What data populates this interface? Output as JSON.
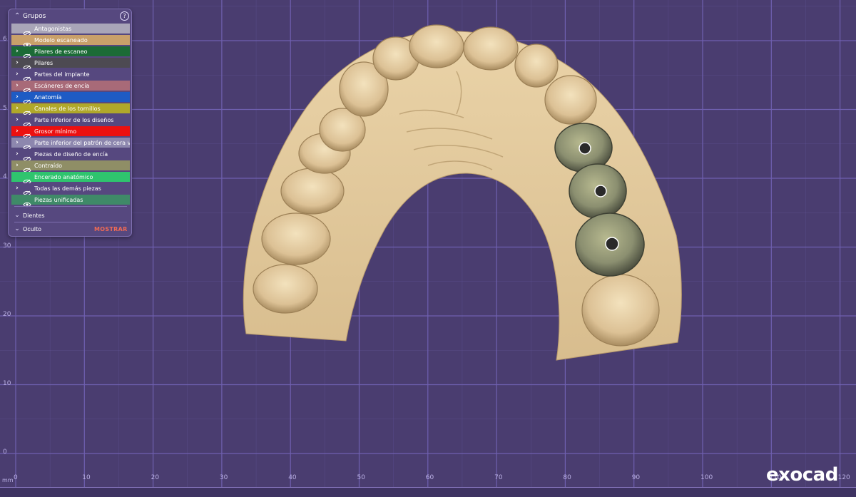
{
  "viewport": {
    "background": "#4a3d70",
    "grid_color": "#6f60b0",
    "unit": "mm",
    "y_ticks": [
      {
        "v": 60,
        "label": "6"
      },
      {
        "v": 50,
        "label": "5"
      },
      {
        "v": 40,
        "label": "4"
      },
      {
        "v": 30,
        "label": "30"
      },
      {
        "v": 20,
        "label": "20"
      },
      {
        "v": 10,
        "label": "10"
      },
      {
        "v": 0,
        "label": "0"
      }
    ],
    "x_ticks": [
      "0",
      "10",
      "20",
      "30",
      "40",
      "50",
      "60",
      "70",
      "80",
      "90",
      "100",
      "110",
      "120"
    ]
  },
  "panel": {
    "title": "Grupos",
    "help_icon": "question-circle-icon",
    "groups": [
      {
        "label": "Antagonistas",
        "color": "#a9a5b8",
        "expand": false,
        "visible": false
      },
      {
        "label": "Modelo escaneado",
        "color": "#c9a06a",
        "expand": false,
        "visible": true
      },
      {
        "label": "Pilares de escaneo",
        "color": "#1c6b36",
        "expand": true,
        "visible": false
      },
      {
        "label": "Pilares",
        "color": "#4d4a52",
        "expand": true,
        "visible": false
      },
      {
        "label": "Partes del implante",
        "color": "#56487f",
        "expand": true,
        "visible": false
      },
      {
        "label": "Escáneres de encía",
        "color": "#a86a78",
        "expand": true,
        "visible": false
      },
      {
        "label": "Anatomía",
        "color": "#1e5bc4",
        "expand": true,
        "visible": false
      },
      {
        "label": "Canales de los tornillos",
        "color": "#b0a82a",
        "expand": true,
        "visible": false
      },
      {
        "label": "Parte inferior de los diseños",
        "color": "#56487f",
        "expand": true,
        "visible": false
      },
      {
        "label": "Grosor mínimo",
        "color": "#ec1010",
        "expand": true,
        "visible": false
      },
      {
        "label": "Parte inferior del patrón de cera virtua",
        "color": "#8d87ae",
        "expand": true,
        "visible": false
      },
      {
        "label": "Piezas de diseño de encía",
        "color": "#56487f",
        "expand": true,
        "visible": false
      },
      {
        "label": "Contraído",
        "color": "#8f8e66",
        "expand": true,
        "visible": false
      },
      {
        "label": "Encerado anatómico",
        "color": "#2fc46e",
        "expand": false,
        "visible": false
      },
      {
        "label": "Todas las demás piezas",
        "color": "#56487f",
        "expand": true,
        "visible": false
      },
      {
        "label": "Piezas unificadas",
        "color": "#3f8a68",
        "expand": false,
        "visible": true
      }
    ],
    "sections": [
      {
        "label": "Dientes"
      },
      {
        "label": "Oculto"
      }
    ],
    "show_button": "MOSTRAR"
  },
  "model": {
    "model_color": "#e4cca0",
    "abutment_color": "#8b8f70"
  },
  "logo": "exocad"
}
